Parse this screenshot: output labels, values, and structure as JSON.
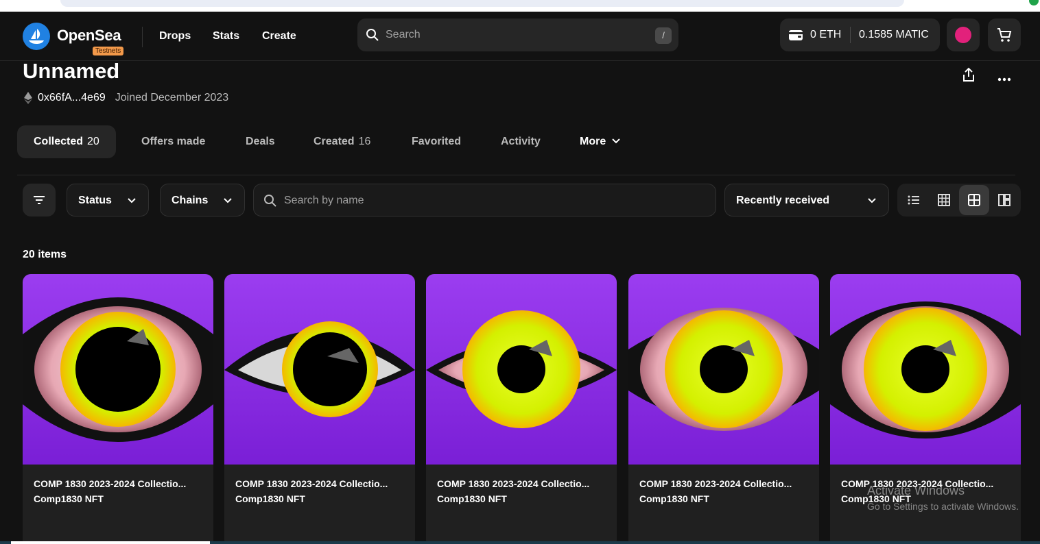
{
  "brand": {
    "name": "OpenSea",
    "badge": "Testnets"
  },
  "nav": {
    "links": [
      "Drops",
      "Stats",
      "Create"
    ]
  },
  "search": {
    "placeholder": "Search",
    "shortcut": "/"
  },
  "wallet": {
    "eth": "0 ETH",
    "matic": "0.1585 MATIC"
  },
  "profile": {
    "name": "Unnamed",
    "address": "0x66fA...4e69",
    "joined": "Joined December 2023"
  },
  "tabs": [
    {
      "label": "Collected",
      "count": "20"
    },
    {
      "label": "Offers made"
    },
    {
      "label": "Deals"
    },
    {
      "label": "Created",
      "count": "16"
    },
    {
      "label": "Favorited"
    },
    {
      "label": "Activity"
    },
    {
      "label": "More"
    }
  ],
  "filters": {
    "status": "Status",
    "chains": "Chains",
    "name_placeholder": "Search by name",
    "sort": "Recently received"
  },
  "items_count": "20 items",
  "items": [
    {
      "title": "COMP 1830 2023-2024 Collectio...",
      "collection": "Comp1830 NFT"
    },
    {
      "title": "COMP 1830 2023-2024 Collectio...",
      "collection": "Comp1830 NFT"
    },
    {
      "title": "COMP 1830 2023-2024 Collectio...",
      "collection": "Comp1830 NFT"
    },
    {
      "title": "COMP 1830 2023-2024 Collectio...",
      "collection": "Comp1830 NFT"
    },
    {
      "title": "COMP 1830 2023-2024 Collectio...",
      "collection": "Comp1830 NFT"
    }
  ],
  "watermark": {
    "line1": "Activate Windows",
    "line2": "Go to Settings to activate Windows."
  },
  "colors": {
    "brand_blue": "#2081e2",
    "background": "#121212",
    "card_purple": "#8a2be2",
    "avatar_pink": "#e2217b",
    "badge_orange": "#f2994a"
  },
  "icons": [
    "search-icon",
    "wallet-icon",
    "cart-icon",
    "share-icon",
    "more-icon",
    "ethereum-icon",
    "filter-icon",
    "chevron-down-icon",
    "list-view-icon",
    "grid-small-icon",
    "grid-large-icon",
    "masonry-icon"
  ]
}
